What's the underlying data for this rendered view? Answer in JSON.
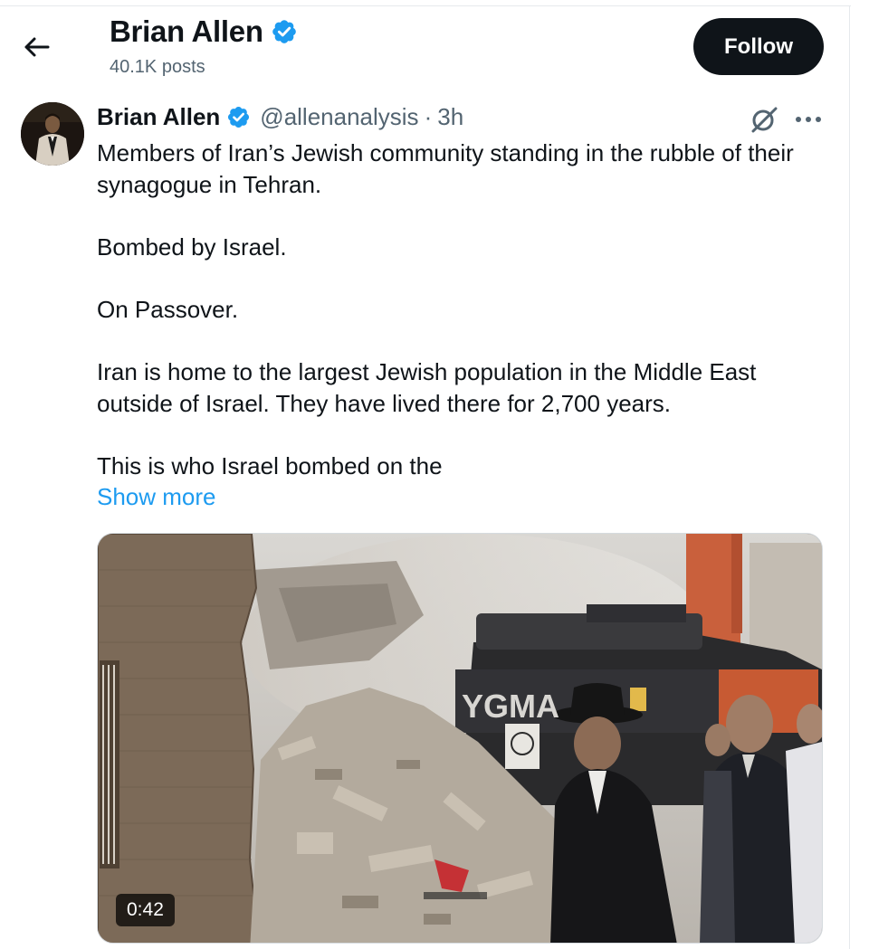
{
  "header": {
    "back_icon": "arrow-left-icon",
    "name": "Brian Allen",
    "verified_icon": "verified-badge-icon",
    "posts_count": "40.1K posts",
    "follow_label": "Follow"
  },
  "tweet": {
    "author_name": "Brian Allen",
    "handle": "@allenanalysis",
    "separator": "·",
    "time": "3h",
    "grok_icon": "grok-icon",
    "more_icon": "more-icon",
    "paragraphs": [
      "Members of Iran’s Jewish community standing in the rubble of their synagogue in Tehran.",
      "Bombed by Israel.",
      "On Passover.",
      "Iran is home to the largest Jewish population in the Middle East outside of Israel. They have lived there for 2,700 years.",
      "This is who Israel bombed on the"
    ],
    "show_more": "Show more"
  },
  "media": {
    "type": "video",
    "duration": "0:42",
    "excavator_brand": "YGMA"
  },
  "colors": {
    "text_primary": "#0f1419",
    "text_secondary": "#536471",
    "link": "#1d9bf0",
    "verified": "#1d9bf0",
    "follow_bg": "#0f1419"
  }
}
